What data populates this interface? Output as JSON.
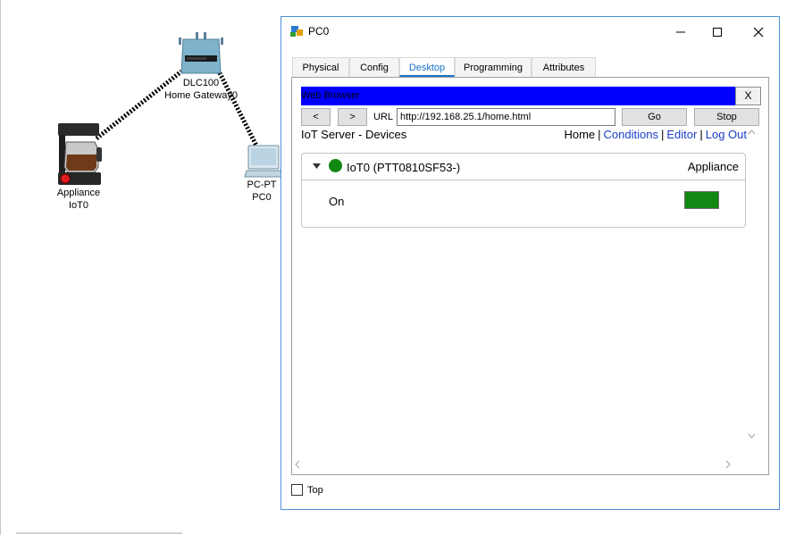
{
  "workspace": {
    "devices": [
      {
        "id": "appliance",
        "name_line1": "Appliance",
        "name_line2": "IoT0",
        "icon": "coffee-maker-icon"
      },
      {
        "id": "gateway",
        "name_line1": "DLC100",
        "name_line2": "Home Gateway0",
        "icon": "home-gateway-icon"
      },
      {
        "id": "pc",
        "name_line1": "PC-PT",
        "name_line2": "PC0",
        "icon": "pc-icon"
      }
    ]
  },
  "window": {
    "title": "PC0",
    "tabs": [
      {
        "label": "Physical",
        "active": false
      },
      {
        "label": "Config",
        "active": false
      },
      {
        "label": "Desktop",
        "active": true
      },
      {
        "label": "Programming",
        "active": false
      },
      {
        "label": "Attributes",
        "active": false
      }
    ],
    "top_checkbox_label": "Top",
    "top_checked": false
  },
  "browser": {
    "title": "Web Browser",
    "close_label": "X",
    "back_label": "<",
    "forward_label": ">",
    "url_label": "URL",
    "url": "http://192.168.25.1/home.html",
    "go_label": "Go",
    "stop_label": "Stop"
  },
  "iot_page": {
    "title": "IoT Server - Devices",
    "nav": {
      "home": "Home",
      "conditions": "Conditions",
      "editor": "Editor",
      "logout": "Log Out",
      "separator": "|"
    },
    "device": {
      "name": "IoT0 (PTT0810SF53-)",
      "type": "Appliance",
      "status_color": "#118811",
      "property_label": "On",
      "property_color": "#118811"
    }
  },
  "colors": {
    "accent": "#1a73c9",
    "browser_title_bg": "#0000ff",
    "link": "#1a3dc9",
    "window_border": "#4f8fd6"
  }
}
